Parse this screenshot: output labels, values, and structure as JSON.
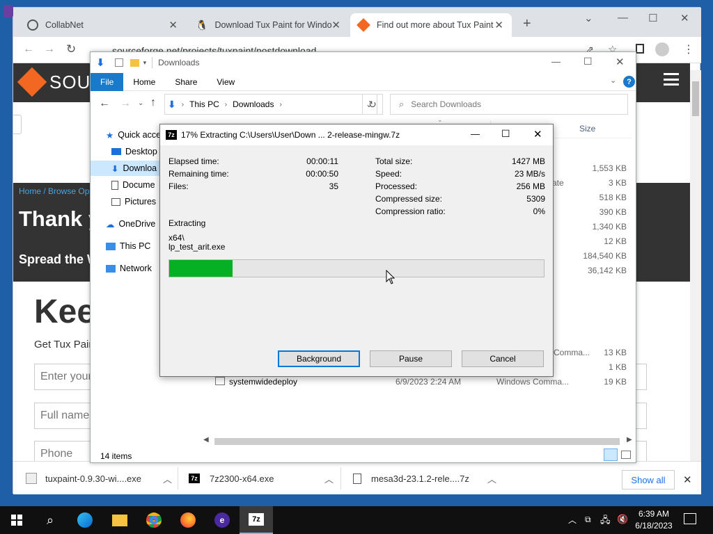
{
  "chrome": {
    "tabs": [
      {
        "title": "CollabNet",
        "icon": "collabnet-icon"
      },
      {
        "title": "Download Tux Paint for Window",
        "icon": "tux-icon"
      },
      {
        "title": "Find out more about Tux Paint |",
        "icon": "sourceforge-icon"
      }
    ],
    "new_tab": "+",
    "url": "sourceforge.net/projects/tuxpaint/postdownload"
  },
  "page": {
    "logo_text": "SOUR",
    "breadcrumb": "Home / Browse Ope",
    "heading": "Thank y",
    "spread": "Spread the W",
    "keep": "Kee",
    "get": "Get Tux Pair",
    "field_email": "Enter your",
    "field_name": "Full name",
    "field_phone": "Phone"
  },
  "downloads_bar": {
    "items": [
      {
        "name": "tuxpaint-0.9.30-wi....exe"
      },
      {
        "name": "7z2300-x64.exe"
      },
      {
        "name": "mesa3d-23.1.2-rele....7z"
      }
    ],
    "show_all": "Show all"
  },
  "explorer": {
    "title": "Downloads",
    "ribbon": {
      "file": "File",
      "home": "Home",
      "share": "Share",
      "view": "View"
    },
    "path": [
      "This PC",
      "Downloads"
    ],
    "search_placeholder": "Search Downloads",
    "size_header": "Size",
    "nav": [
      "Quick acce",
      "Desktop",
      "Downloa",
      "Docume",
      "Pictures",
      "OneDrive",
      "This PC",
      "Network"
    ],
    "sizes": [
      "1,553 KB",
      "3 KB",
      "518 KB",
      "390 KB",
      "1,340 KB",
      "12 KB",
      "184,540 KB",
      "36,142 KB"
    ],
    "partial_type": "ate",
    "bottom_rows": [
      {
        "name": "",
        "date": "",
        "type": "Comma...",
        "size": "13 KB"
      },
      {
        "name": "",
        "date": "",
        "type": "",
        "size": "1 KB"
      },
      {
        "name": "systemwidedeploy",
        "date": "6/9/2023 2:24 AM",
        "type": "Windows Comma...",
        "size": "19 KB"
      }
    ],
    "status": "14 items"
  },
  "dialog": {
    "title": "17% Extracting C:\\Users\\User\\Down ... 2-release-mingw.7z",
    "left": [
      {
        "label": "Elapsed time:",
        "value": "00:00:11"
      },
      {
        "label": "Remaining time:",
        "value": "00:00:50"
      },
      {
        "label": "Files:",
        "value": "35"
      }
    ],
    "right": [
      {
        "label": "Total size:",
        "value": "1427 MB"
      },
      {
        "label": "Speed:",
        "value": "23 MB/s"
      },
      {
        "label": "Processed:",
        "value": "256 MB"
      },
      {
        "label": "Compressed size:",
        "value": "5309"
      },
      {
        "label": "Compression ratio:",
        "value": "0%"
      }
    ],
    "action": "Extracting",
    "folder": "x64\\",
    "file": "lp_test_arit.exe",
    "progress_fraction": 0.17,
    "buttons": {
      "background": "Background",
      "pause": "Pause",
      "cancel": "Cancel"
    }
  },
  "taskbar": {
    "time": "6:39 AM",
    "date": "6/18/2023"
  },
  "colors": {
    "progress": "#06b025",
    "sf_orange": "#f26822",
    "accent": "#0078d7"
  }
}
